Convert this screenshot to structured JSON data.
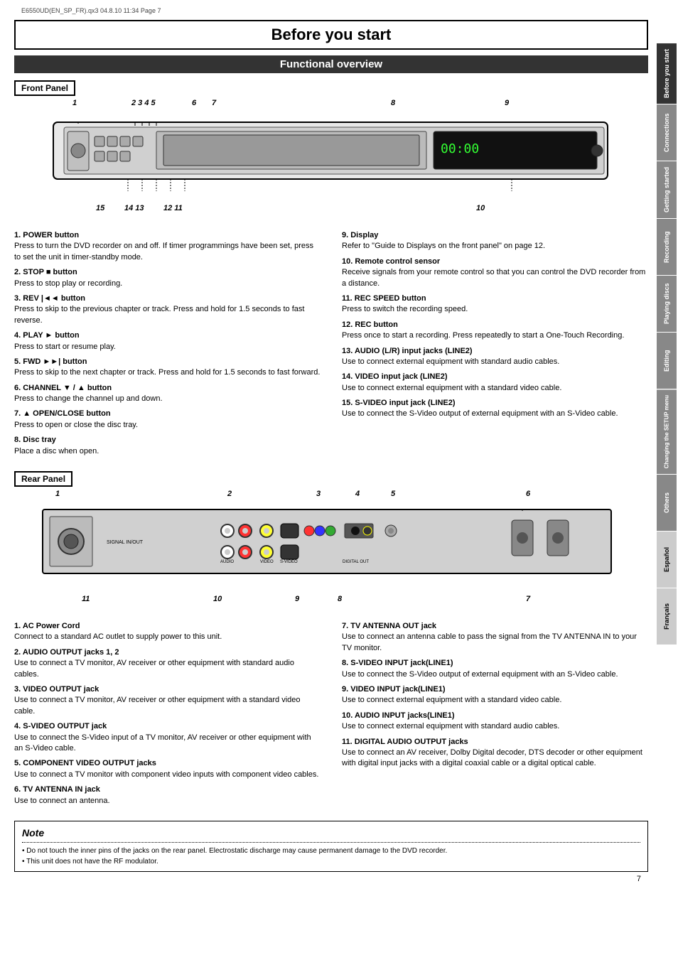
{
  "meta": {
    "file_info": "E6550UD(EN_SP_FR).qx3  04.8.10  11:34  Page 7"
  },
  "page_title": "Before you start",
  "section_title": "Functional overview",
  "sidebar_tabs": [
    {
      "label": "Before you start",
      "active": true
    },
    {
      "label": "Connections",
      "active": false
    },
    {
      "label": "Getting started",
      "active": false
    },
    {
      "label": "Recording",
      "active": false
    },
    {
      "label": "Playing discs",
      "active": false
    },
    {
      "label": "Editing",
      "active": false
    },
    {
      "label": "Changing the SETUP menu",
      "active": false
    },
    {
      "label": "Others",
      "active": false
    },
    {
      "label": "Español",
      "active": false
    },
    {
      "label": "Français",
      "active": false
    }
  ],
  "front_panel": {
    "label": "Front Panel",
    "numbers_top": [
      "1",
      "2",
      "3",
      "4",
      "5",
      "6",
      "7",
      "",
      "",
      "8",
      "",
      "",
      "",
      "9"
    ],
    "numbers_bottom": [
      "15",
      "14",
      "13",
      "12",
      "11",
      "",
      "",
      "",
      "",
      "",
      "10"
    ],
    "items": [
      {
        "num": "1.",
        "title": "POWER button",
        "body": "Press to turn the DVD recorder on and off. If timer programmings have been set, press to set the unit in timer-standby mode."
      },
      {
        "num": "2.",
        "title": "STOP ■ button",
        "body": "Press to stop play or recording."
      },
      {
        "num": "3.",
        "title": "REV |◄◄ button",
        "body": "Press to skip to the previous chapter or track. Press and hold for 1.5 seconds to fast reverse."
      },
      {
        "num": "4.",
        "title": "PLAY ► button",
        "body": "Press to start or resume play."
      },
      {
        "num": "5.",
        "title": "FWD ►►| button",
        "body": "Press to skip to the next chapter or track. Press and hold for 1.5 seconds to fast forward."
      },
      {
        "num": "6.",
        "title": "CHANNEL ▼ / ▲ button",
        "body": "Press to change the channel up and down."
      },
      {
        "num": "7.",
        "title": "▲ OPEN/CLOSE button",
        "body": "Press to open or close the disc tray."
      },
      {
        "num": "8.",
        "title": "Disc tray",
        "body": "Place a disc when open."
      },
      {
        "num": "9.",
        "title": "Display",
        "body": "Refer to \"Guide to Displays on the front panel\" on page 12."
      },
      {
        "num": "10.",
        "title": "Remote control sensor",
        "body": "Receive signals from your remote control so that you can control the DVD recorder from a distance."
      },
      {
        "num": "11.",
        "title": "REC SPEED button",
        "body": "Press to switch the recording speed."
      },
      {
        "num": "12.",
        "title": "REC button",
        "body": "Press once to start a recording. Press repeatedly to start a One-Touch Recording."
      },
      {
        "num": "13.",
        "title": "AUDIO (L/R) input jacks (LINE2)",
        "body": "Use to connect external equipment with standard audio cables."
      },
      {
        "num": "14.",
        "title": "VIDEO input jack (LINE2)",
        "body": "Use to connect external equipment with a standard video cable."
      },
      {
        "num": "15.",
        "title": "S-VIDEO input jack (LINE2)",
        "body": "Use to connect the S-Video output of external equipment with an S-Video cable."
      }
    ]
  },
  "rear_panel": {
    "label": "Rear Panel",
    "numbers_top": [
      "1",
      "",
      "",
      "2",
      "",
      "3",
      "4",
      "5",
      "",
      "",
      "6"
    ],
    "numbers_bottom": [
      "11",
      "",
      "10",
      "",
      "9",
      "",
      "8",
      "",
      "7"
    ],
    "items": [
      {
        "num": "1.",
        "title": "AC Power Cord",
        "body": "Connect to a standard AC outlet to supply power to this unit."
      },
      {
        "num": "2.",
        "title": "AUDIO OUTPUT jacks 1, 2",
        "body": "Use to connect a TV monitor, AV receiver or other equipment with standard audio cables."
      },
      {
        "num": "3.",
        "title": "VIDEO OUTPUT jack",
        "body": "Use to connect a TV monitor, AV receiver or other equipment with a standard video cable."
      },
      {
        "num": "4.",
        "title": "S-VIDEO OUTPUT jack",
        "body": "Use to connect the S-Video input of a TV monitor, AV receiver or other equipment with an S-Video cable."
      },
      {
        "num": "5.",
        "title": "COMPONENT VIDEO OUTPUT jacks",
        "body": "Use to connect a TV monitor with component video inputs with component video cables."
      },
      {
        "num": "6.",
        "title": "TV ANTENNA IN jack",
        "body": "Use to connect an antenna."
      },
      {
        "num": "7.",
        "title": "TV ANTENNA OUT jack",
        "body": "Use to connect an antenna cable to pass the signal from the TV ANTENNA IN to your TV monitor."
      },
      {
        "num": "8.",
        "title": "S-VIDEO INPUT jack(LINE1)",
        "body": "Use to connect the S-Video output of external equipment with an S-Video cable."
      },
      {
        "num": "9.",
        "title": "VIDEO INPUT jack(LINE1)",
        "body": "Use to connect external equipment with a standard video cable."
      },
      {
        "num": "10.",
        "title": "AUDIO INPUT jacks(LINE1)",
        "body": "Use to connect external equipment with standard audio cables."
      },
      {
        "num": "11.",
        "title": "DIGITAL AUDIO OUTPUT jacks",
        "body": "Use to connect an AV receiver, Dolby Digital decoder, DTS decoder or other equipment with digital input jacks with a digital coaxial cable or a digital optical cable."
      }
    ]
  },
  "note": {
    "title": "Note",
    "bullets": [
      "Do not touch the inner pins of the jacks on the rear panel. Electrostatic discharge may cause permanent damage to the DVD recorder.",
      "This unit does not have the RF modulator."
    ]
  },
  "page_number": "7"
}
